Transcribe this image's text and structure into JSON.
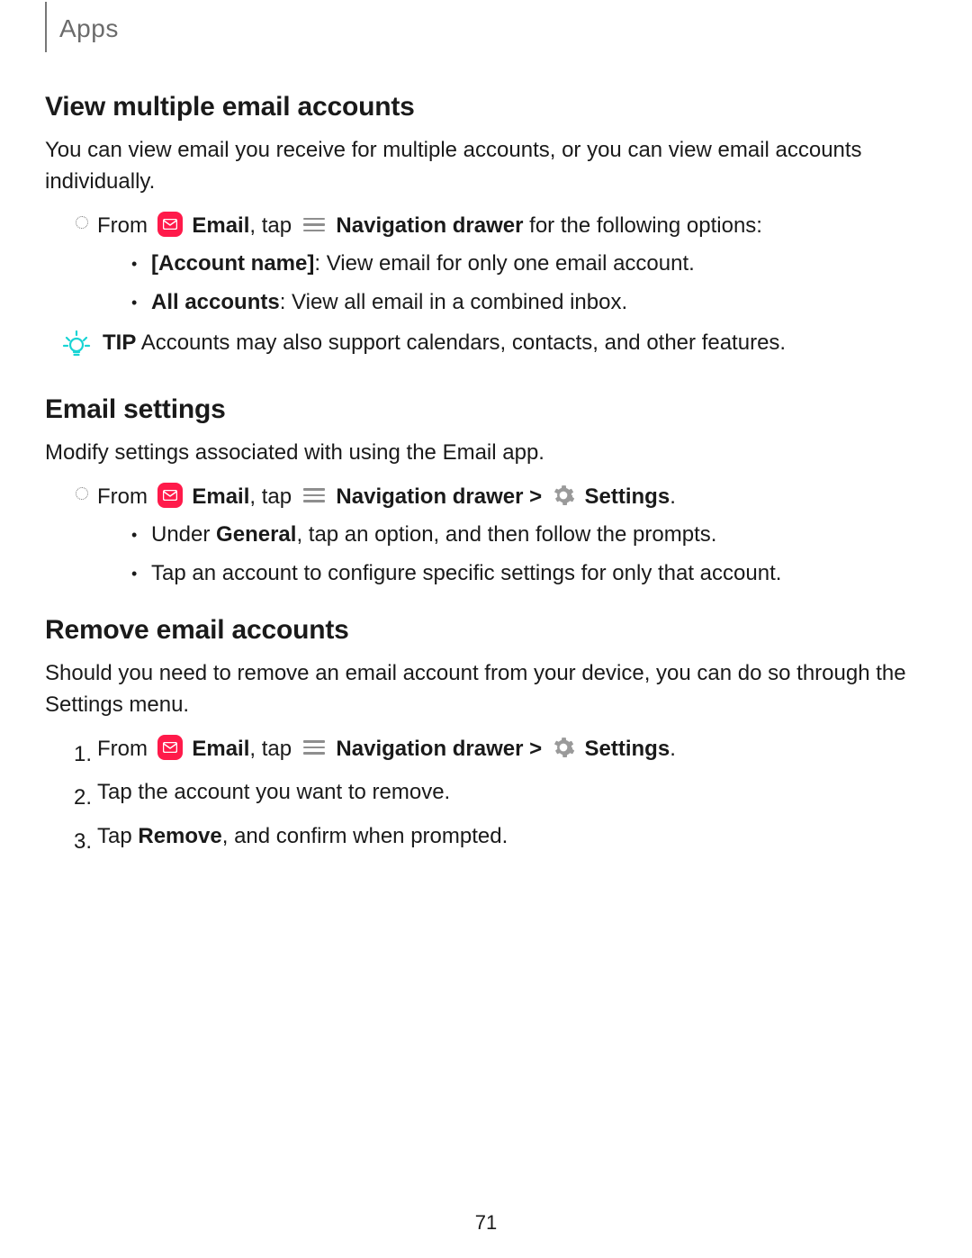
{
  "header": {
    "title": "Apps"
  },
  "page_number": "71",
  "sections": {
    "s1": {
      "heading": "View multiple email accounts",
      "intro": "You can view email you receive for multiple accounts, or you can view email accounts individually.",
      "step1": {
        "from": "From ",
        "email_label": "Email",
        "tap": ", tap ",
        "nav_label": "Navigation drawer",
        "tail": " for the following options:"
      },
      "bullets": {
        "b1_label": "[Account name]",
        "b1_text": ": View email for only one email account.",
        "b2_label": "All accounts",
        "b2_text": ": View all email in a combined inbox."
      },
      "tip_label": "TIP",
      "tip_text": "  Accounts may also support calendars, contacts, and other features."
    },
    "s2": {
      "heading": "Email settings",
      "intro": "Modify settings associated with using the Email app.",
      "step1": {
        "from": "From ",
        "email_label": "Email",
        "tap": ", tap ",
        "nav_label": "Navigation drawer",
        "sep": " > ",
        "settings_label": "Settings",
        "tail": "."
      },
      "bullets": {
        "b1_pre": "Under ",
        "b1_label": "General",
        "b1_text": ", tap an option, and then follow the prompts.",
        "b2_text": "Tap an account to configure specific settings for only that account."
      }
    },
    "s3": {
      "heading": "Remove email accounts",
      "intro": "Should you need to remove an email account from your device, you can do so through the Settings menu.",
      "step1": {
        "num": "1.",
        "from": "From ",
        "email_label": "Email",
        "tap": ", tap ",
        "nav_label": "Navigation drawer",
        "sep": " > ",
        "settings_label": "Settings",
        "tail": "."
      },
      "step2": {
        "num": "2.",
        "text": "Tap the account you want to remove."
      },
      "step3": {
        "num": "3.",
        "pre": "Tap ",
        "label": "Remove",
        "text": ", and confirm when prompted."
      }
    }
  }
}
